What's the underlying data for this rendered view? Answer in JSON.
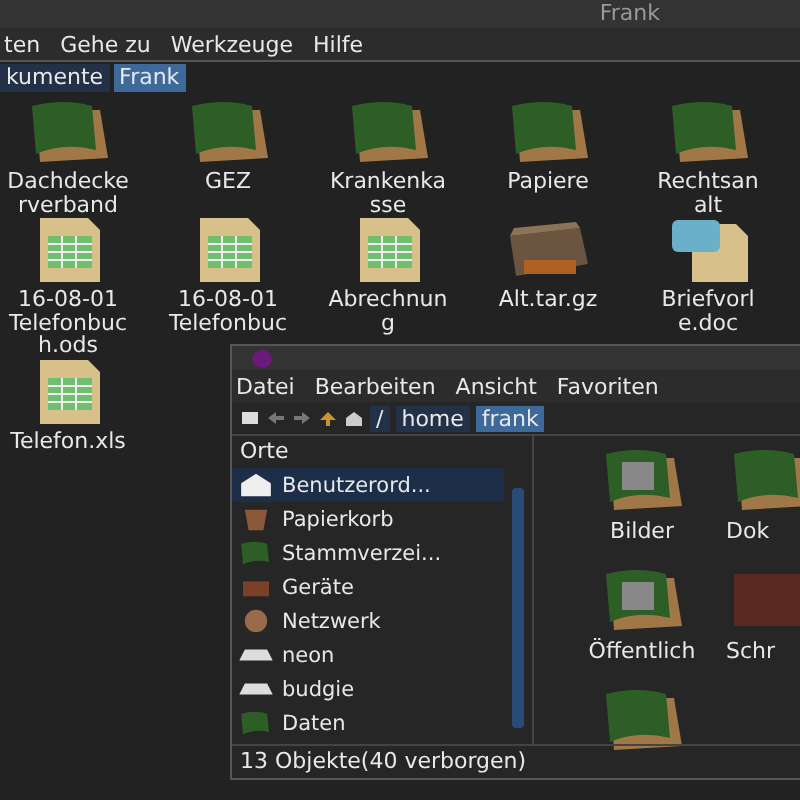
{
  "back_window": {
    "title": "Frank",
    "menu": [
      "ten",
      "Gehe zu",
      "Werkzeuge",
      "Hilfe"
    ],
    "breadcrumb": [
      {
        "label": "kumente",
        "selected": false
      },
      {
        "label": "Frank",
        "selected": true
      }
    ],
    "items": [
      {
        "kind": "folder",
        "lines": [
          "Dachdecke",
          "rverband"
        ]
      },
      {
        "kind": "folder",
        "lines": [
          "GEZ"
        ]
      },
      {
        "kind": "folder",
        "lines": [
          "Krankenka",
          "sse"
        ]
      },
      {
        "kind": "folder",
        "lines": [
          "Papiere"
        ]
      },
      {
        "kind": "folder",
        "lines": [
          "Rechtsan",
          "alt"
        ]
      },
      {
        "kind": "sheet",
        "lines": [
          "16-08-01",
          "Telefonbuc",
          "h.ods"
        ]
      },
      {
        "kind": "sheet",
        "lines": [
          "16-08-01",
          "Telefonbuc"
        ]
      },
      {
        "kind": "sheet",
        "lines": [
          "Abrechnun",
          "g"
        ]
      },
      {
        "kind": "archive",
        "lines": [
          "Alt.tar.gz"
        ]
      },
      {
        "kind": "doc",
        "lines": [
          "Briefvorl",
          "e.doc"
        ]
      },
      {
        "kind": "sheet",
        "lines": [
          "Telefon.xls"
        ]
      }
    ]
  },
  "front_window": {
    "menu": [
      "Datei",
      "Bearbeiten",
      "Ansicht",
      "Favoriten"
    ],
    "path": [
      {
        "label": "/",
        "selected": false
      },
      {
        "label": "home",
        "selected": false
      },
      {
        "label": "frank",
        "selected": true
      }
    ],
    "sidebar": {
      "header": "Orte",
      "items": [
        {
          "kind": "home",
          "label": "Benutzerord...",
          "selected": true
        },
        {
          "kind": "trash",
          "label": "Papierkorb",
          "selected": false
        },
        {
          "kind": "folder",
          "label": "Stammverzei...",
          "selected": false
        },
        {
          "kind": "devices",
          "label": "Geräte",
          "selected": false
        },
        {
          "kind": "network",
          "label": "Netzwerk",
          "selected": false
        },
        {
          "kind": "drive",
          "label": "neon",
          "selected": false
        },
        {
          "kind": "drive",
          "label": "budgie",
          "selected": false
        },
        {
          "kind": "folder",
          "label": "Daten",
          "selected": false
        }
      ]
    },
    "items": [
      {
        "kind": "photo-folder",
        "label": "Bilder"
      },
      {
        "kind": "folder",
        "label": "Dok"
      },
      {
        "kind": "photo-folder",
        "label": "Öffentlich"
      },
      {
        "kind": "video",
        "label": "Schr"
      },
      {
        "kind": "folder"
      }
    ],
    "status": "13 Objekte(40 verborgen)"
  }
}
